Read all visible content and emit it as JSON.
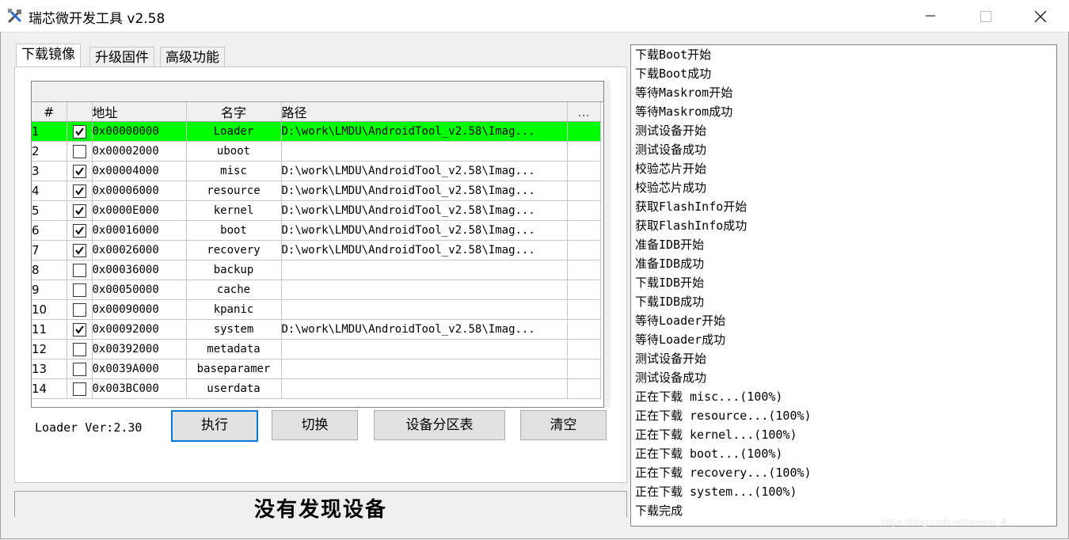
{
  "window": {
    "title": "瑞芯微开发工具 v2.58",
    "controls": {
      "minimize": "minimize",
      "maximize": "maximize",
      "close": "close"
    }
  },
  "tabs": [
    {
      "label": "下载镜像",
      "active": true
    },
    {
      "label": "升级固件",
      "active": false
    },
    {
      "label": "高级功能",
      "active": false
    }
  ],
  "table": {
    "columns": [
      "#",
      "",
      "地址",
      "名字",
      "路径",
      "..."
    ],
    "rows": [
      {
        "num": "1",
        "checked": true,
        "address": "0x00000000",
        "name": "Loader",
        "path": "D:\\work\\LMDU\\AndroidTool_v2.58\\Imag...",
        "selected": true
      },
      {
        "num": "2",
        "checked": false,
        "address": "0x00002000",
        "name": "uboot",
        "path": ""
      },
      {
        "num": "3",
        "checked": true,
        "address": "0x00004000",
        "name": "misc",
        "path": "D:\\work\\LMDU\\AndroidTool_v2.58\\Imag..."
      },
      {
        "num": "4",
        "checked": true,
        "address": "0x00006000",
        "name": "resource",
        "path": "D:\\work\\LMDU\\AndroidTool_v2.58\\Imag..."
      },
      {
        "num": "5",
        "checked": true,
        "address": "0x0000E000",
        "name": "kernel",
        "path": "D:\\work\\LMDU\\AndroidTool_v2.58\\Imag..."
      },
      {
        "num": "6",
        "checked": true,
        "address": "0x00016000",
        "name": "boot",
        "path": "D:\\work\\LMDU\\AndroidTool_v2.58\\Imag..."
      },
      {
        "num": "7",
        "checked": true,
        "address": "0x00026000",
        "name": "recovery",
        "path": "D:\\work\\LMDU\\AndroidTool_v2.58\\Imag..."
      },
      {
        "num": "8",
        "checked": false,
        "address": "0x00036000",
        "name": "backup",
        "path": ""
      },
      {
        "num": "9",
        "checked": false,
        "address": "0x00050000",
        "name": "cache",
        "path": ""
      },
      {
        "num": "10",
        "checked": false,
        "address": "0x00090000",
        "name": "kpanic",
        "path": ""
      },
      {
        "num": "11",
        "checked": true,
        "address": "0x00092000",
        "name": "system",
        "path": "D:\\work\\LMDU\\AndroidTool_v2.58\\Imag..."
      },
      {
        "num": "12",
        "checked": false,
        "address": "0x00392000",
        "name": "metadata",
        "path": ""
      },
      {
        "num": "13",
        "checked": false,
        "address": "0x0039A000",
        "name": "baseparamer",
        "path": ""
      },
      {
        "num": "14",
        "checked": false,
        "address": "0x003BC000",
        "name": "userdata",
        "path": ""
      }
    ]
  },
  "loader_version": "Loader Ver:2.30",
  "buttons": {
    "execute": "执行",
    "switch": "切换",
    "partition_table": "设备分区表",
    "clear": "清空"
  },
  "status": "没有发现设备",
  "log": [
    "下载Boot开始",
    "下载Boot成功",
    "等待Maskrom开始",
    "等待Maskrom成功",
    "测试设备开始",
    "测试设备成功",
    "校验芯片开始",
    "校验芯片成功",
    "获取FlashInfo开始",
    "获取FlashInfo成功",
    "准备IDB开始",
    "准备IDB成功",
    "下载IDB开始",
    "下载IDB成功",
    "等待Loader开始",
    "等待Loader成功",
    "测试设备开始",
    "测试设备成功",
    "正在下载 misc...(100%)",
    "正在下载 resource...(100%)",
    "正在下载 kernel...(100%)",
    "正在下载 boot...(100%)",
    "正在下载 recovery...(100%)",
    "正在下载 system...(100%)",
    "下载完成"
  ],
  "watermark": "https://blog.csdn.net/weixin_4..."
}
